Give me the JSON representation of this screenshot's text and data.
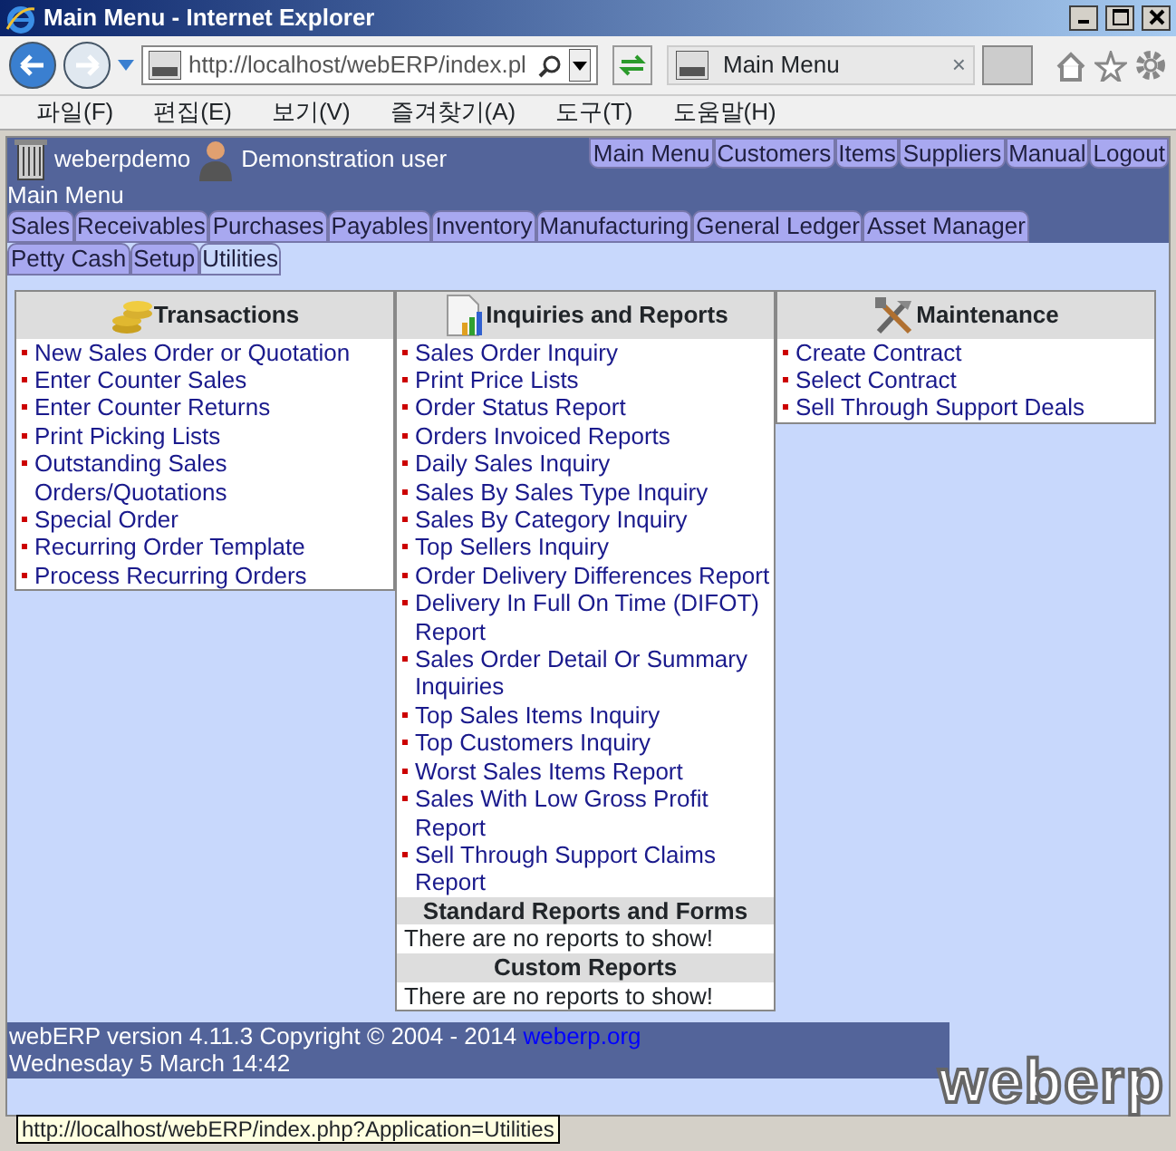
{
  "window": {
    "title": "Main Menu - Internet Explorer"
  },
  "browser": {
    "address": "http://localhost/webERP/index.pl",
    "tab_title": "Main Menu",
    "tab_close": "×",
    "menu": [
      "파일(F)",
      "편집(E)",
      "보기(V)",
      "즐겨찾기(A)",
      "도구(T)",
      "도움말(H)"
    ]
  },
  "header": {
    "company": "weberpdemo",
    "user": "Demonstration user",
    "links": [
      "Main Menu",
      "Customers",
      "Items",
      "Suppliers",
      "Manual",
      "Logout"
    ],
    "page_title": "Main Menu"
  },
  "modules": [
    {
      "label": "Sales",
      "selected": false
    },
    {
      "label": "Receivables",
      "selected": false
    },
    {
      "label": "Purchases",
      "selected": false
    },
    {
      "label": "Payables",
      "selected": false
    },
    {
      "label": "Inventory",
      "selected": false
    },
    {
      "label": "Manufacturing",
      "selected": false
    },
    {
      "label": "General Ledger",
      "selected": false
    },
    {
      "label": "Asset Manager",
      "selected": false
    },
    {
      "label": "Petty Cash",
      "selected": false
    },
    {
      "label": "Setup",
      "selected": false
    },
    {
      "label": "Utilities",
      "selected": true
    }
  ],
  "panels": [
    {
      "title": "Transactions",
      "items": [
        "New Sales Order or Quotation",
        "Enter Counter Sales",
        "Enter Counter Returns",
        "Print Picking Lists",
        "Outstanding Sales Orders/Quotations",
        "Special Order",
        "Recurring Order Template",
        "Process Recurring Orders"
      ]
    },
    {
      "title": "Inquiries and Reports",
      "items": [
        "Sales Order Inquiry",
        "Print Price Lists",
        "Order Status Report",
        "Orders Invoiced Reports",
        "Daily Sales Inquiry",
        "Sales By Sales Type Inquiry",
        "Sales By Category Inquiry",
        "Top Sellers Inquiry",
        "Order Delivery Differences Report",
        "Delivery In Full On Time (DIFOT) Report",
        "Sales Order Detail Or Summary Inquiries",
        "Top Sales Items Inquiry",
        "Top Customers Inquiry",
        "Worst Sales Items Report",
        "Sales With Low Gross Profit Report",
        "Sell Through Support Claims Report"
      ],
      "sections": [
        {
          "title": "Standard Reports and Forms",
          "text": "There are no reports to show!"
        },
        {
          "title": "Custom Reports",
          "text": "There are no reports to show!"
        }
      ]
    },
    {
      "title": "Maintenance",
      "items": [
        "Create Contract",
        "Select Contract",
        "Sell Through Support Deals"
      ]
    }
  ],
  "footer": {
    "version": "webERP version 4.11.3 Copyright © 2004 - 2014",
    "link": "weberp.org",
    "date": "Wednesday 5 March 14:42",
    "logo": "weberp"
  },
  "status_tooltip": "http://localhost/webERP/index.php?Application=Utilities"
}
